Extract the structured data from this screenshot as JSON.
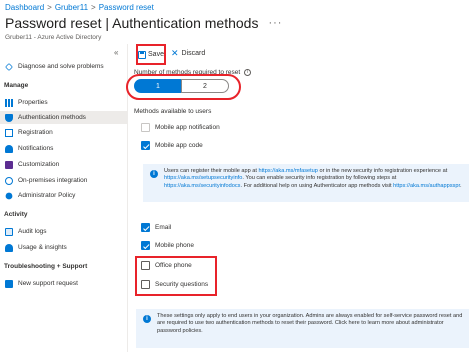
{
  "breadcrumb": [
    "Dashboard",
    "Gruber11",
    "Password reset"
  ],
  "header": {
    "title": "Password reset | Authentication methods",
    "subtitle": "Gruber11 - Azure Active Directory",
    "more": "···"
  },
  "sidebar": {
    "collapse": "«",
    "top_item": "Diagnose and solve problems",
    "sections": {
      "manage": "Manage",
      "activity": "Activity",
      "troubleshooting": "Troubleshooting + Support"
    },
    "manage_items": [
      {
        "label": "Properties",
        "icon": "properties-icon"
      },
      {
        "label": "Authentication methods",
        "icon": "shield-icon"
      },
      {
        "label": "Registration",
        "icon": "registration-icon"
      },
      {
        "label": "Notifications",
        "icon": "bell-icon"
      },
      {
        "label": "Customization",
        "icon": "customization-icon"
      },
      {
        "label": "On-premises integration",
        "icon": "sync-icon"
      },
      {
        "label": "Administrator Policy",
        "icon": "policy-icon"
      }
    ],
    "activity_items": [
      {
        "label": "Audit logs",
        "icon": "audit-log-icon"
      },
      {
        "label": "Usage & insights",
        "icon": "usage-icon"
      }
    ],
    "support_items": [
      {
        "label": "New support request",
        "icon": "support-icon"
      }
    ]
  },
  "toolbar": {
    "save_label": "Save",
    "discard_label": "Discard"
  },
  "methods_required": {
    "label": "Number of methods required to reset",
    "options": [
      "1",
      "2"
    ],
    "selected": "1"
  },
  "methods": {
    "label": "Methods available to users",
    "items": [
      {
        "label": "Mobile app notification",
        "checked": false
      },
      {
        "label": "Mobile app code",
        "checked": true
      },
      {
        "label": "Email",
        "checked": true
      },
      {
        "label": "Mobile phone",
        "checked": true
      },
      {
        "label": "Office phone",
        "checked": false
      },
      {
        "label": "Security questions",
        "checked": false
      }
    ]
  },
  "info1": {
    "line1": "Users can register their mobile app at ",
    "link1": "https://aka.ms/mfasetup",
    "line1b": " or in the new security info registration experience at",
    "link2": "https://aka.ms/setupsecurityinfo",
    "line2": ". You can enable security info registration by following steps at",
    "link3": "https://aka.ms/securityinfodocs",
    "line3": ". For additional help on using Authenticator app methods visit",
    "link4": "https://aka.ms/authappsspr",
    "line4": "."
  },
  "info2": {
    "text": "These settings only apply to end users in your organization. Admins are always enabled for self-service password reset and are required to use two authentication methods to reset their password. Click here to learn more about administrator password policies."
  },
  "colors": {
    "accent": "#0078d4",
    "highlight": "#e8232a",
    "info_bg": "#ebf3fc"
  }
}
